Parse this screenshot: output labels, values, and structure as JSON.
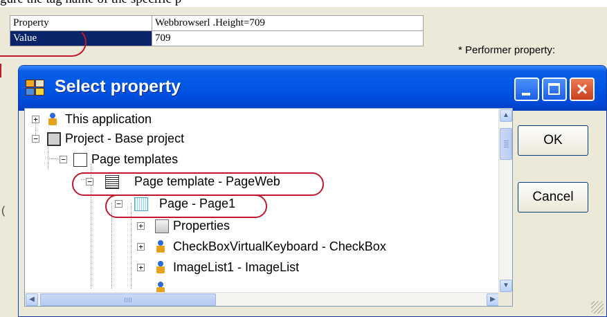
{
  "caption": "gure the tag name of the specific p",
  "background_grid": {
    "rows": [
      {
        "name": "Property",
        "value": "Webbrowserl .Height=709"
      },
      {
        "name": "Value",
        "value": "709"
      }
    ],
    "note": "* Performer property:"
  },
  "dialog": {
    "title": "Select property",
    "buttons": {
      "ok": "OK",
      "cancel": "Cancel"
    },
    "tree": [
      {
        "label": "This application",
        "icon": "wizard-icon",
        "expander": "+"
      },
      {
        "label": "Project - Base project",
        "icon": "project-icon",
        "expander": "−"
      },
      {
        "label": "Page templates",
        "icon": "page-icon",
        "expander": "−"
      },
      {
        "label": "Page template - PageWeb",
        "icon": "grid-icon",
        "expander": "−",
        "highlighted": true
      },
      {
        "label": "Page - Page1",
        "icon": "page1-icon",
        "expander": "−",
        "highlighted": true
      },
      {
        "label": "Properties",
        "icon": "properties-icon",
        "expander": "+"
      },
      {
        "label": "CheckBoxVirtualKeyboard - CheckBox",
        "icon": "wizard-icon",
        "expander": "+"
      },
      {
        "label": "ImageList1 - ImageList",
        "icon": "wizard-icon",
        "expander": "+"
      }
    ]
  },
  "colors": {
    "title_blue": "#0055e5",
    "highlight_red": "#c0182a",
    "selection_navy": "#0a246a"
  }
}
